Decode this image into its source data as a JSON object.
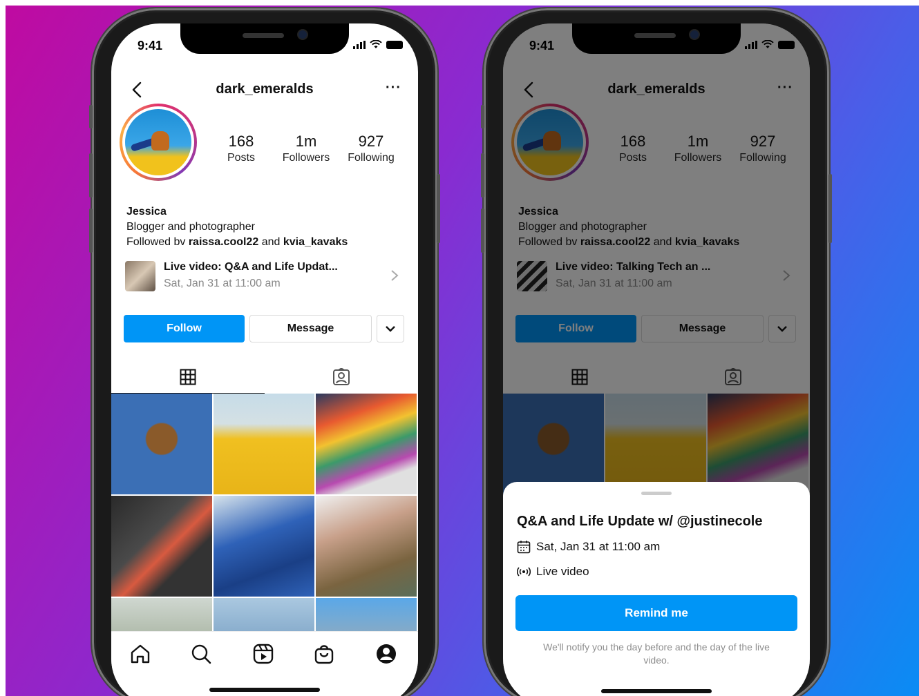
{
  "status": {
    "time": "9:41"
  },
  "profile": {
    "username": "dark_emeralds",
    "more": "···",
    "stats": [
      {
        "num": "168",
        "label": "Posts"
      },
      {
        "num": "1m",
        "label": "Followers"
      },
      {
        "num": "927",
        "label": "Following"
      }
    ],
    "name": "Jessica",
    "bio": "Blogger and photographer",
    "followed_prefix": "Followed bv",
    "followed_user1": "raissa.cool22",
    "followed_and": "and",
    "followed_user2": "kvia_kavaks",
    "follow_label": "Follow",
    "message_label": "Message"
  },
  "left_live": {
    "title": "Live video: Q&A and Life Updat...",
    "date": "Sat, Jan 31 at 11:00 am"
  },
  "right_live": {
    "title": "Live video: Talking Tech an ...",
    "date": "Sat, Jan 31 at 11:00 am"
  },
  "sheet": {
    "title": "Q&A and Life Update w/ @justinecole",
    "date": "Sat, Jan 31 at 11:00 am",
    "type": "Live video",
    "remind_label": "Remind me",
    "note": "We'll notify you the day before and the day of the live video."
  },
  "colors": {
    "accent": "#0095f6",
    "text": "#111111",
    "muted": "#8e8e8e"
  },
  "icons": [
    "back-icon",
    "more-icon",
    "chevron-right-icon",
    "chevron-down-icon",
    "grid-icon",
    "tagged-icon",
    "home-icon",
    "search-icon",
    "reels-icon",
    "shop-icon",
    "profile-icon",
    "calendar-icon",
    "live-icon"
  ]
}
